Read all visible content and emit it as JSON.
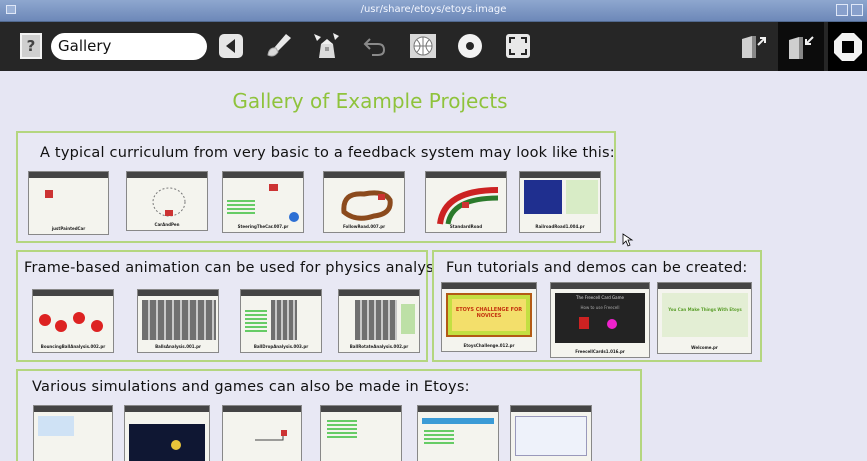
{
  "window": {
    "title": "/usr/share/etoys/etoys.image"
  },
  "toolbar": {
    "help_label": "?",
    "project_name": "Gallery",
    "icons": [
      "help-icon",
      "back-icon",
      "paint-icon",
      "supplies-icon",
      "undo-icon",
      "language-icon",
      "record-icon",
      "fullscreen-icon",
      "keep-icon",
      "find-icon",
      "stop-icon"
    ]
  },
  "page": {
    "title": "Gallery of Example Projects",
    "sections": [
      {
        "heading": "A typical curriculum from very basic to a feedback system may look like this:",
        "thumbs": [
          "justPaintedCar",
          "CarAndPen",
          "SteeringTheCar.007.pr",
          "FollowRoad.007.pr",
          "StandardRoad",
          "RailroadRoad1.004.pr"
        ]
      },
      {
        "heading": "Frame-based animation can be used for physics analysis:",
        "thumbs": [
          "BouncingBallAnalysis.002.pr",
          "BallsAnalysis.001.pr",
          "BallDropAnalysis.003.pr",
          "BallRotateAnalysis.002.pr"
        ]
      },
      {
        "heading": "Fun tutorials and demos can be created:",
        "thumbs": [
          "EtoysChallenge.012.pr",
          "FreecellCards1.016.pr",
          "Welcome.pr"
        ]
      },
      {
        "heading": "Various simulations and games can also be made in Etoys:",
        "thumbs": [
          "",
          "",
          "",
          "",
          "",
          ""
        ]
      }
    ]
  },
  "thumb_texts": {
    "etoys_challenge": "ETOYS CHALLENGE FOR NOVICES",
    "freecell_title": "The Freecell Card Game",
    "freecell_sub": "How to use Freecell",
    "welcome": "You Can Make Things With Etoys"
  },
  "colors": {
    "accent_green": "#8fc33c",
    "panel_border": "#b4d67f",
    "toolbar_bg": "#262626",
    "selection": "#5a5fc0"
  }
}
